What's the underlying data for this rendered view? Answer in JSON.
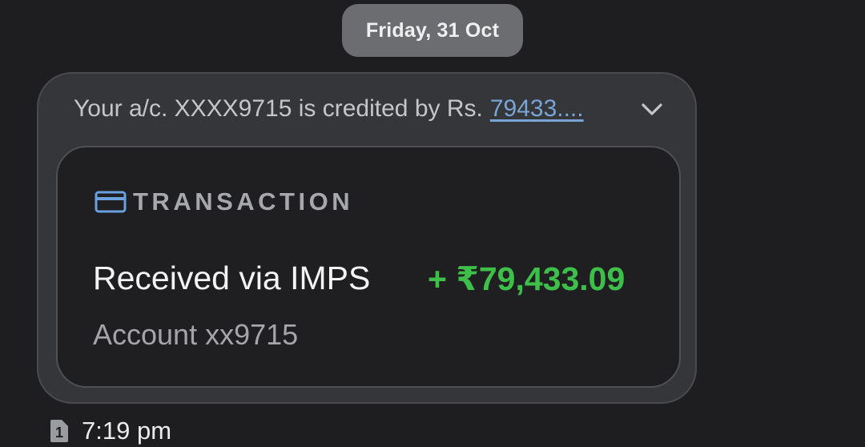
{
  "date_chip": {
    "label": "Friday, 31 Oct"
  },
  "message": {
    "preview_text": "Your a/c. XXXX9715 is credited by Rs.",
    "preview_link": "79433....",
    "expand_icon": "chevron-down-icon"
  },
  "transaction_card": {
    "header_icon": "credit-card-icon",
    "header_label": "TRANSACTION",
    "title": "Received via IMPS",
    "amount": "+ ₹79,433.09",
    "account": "Account xx9715"
  },
  "meta": {
    "sim_icon": "sim-1-icon",
    "sim_label": "1",
    "time": "7:19 pm"
  },
  "colors": {
    "background": "#1e1e21",
    "bubble": "#353639",
    "card": "#1f1f22",
    "link": "#79a5d6",
    "amount_green": "#3dbf4a",
    "card_icon_blue": "#6aa0dc"
  }
}
